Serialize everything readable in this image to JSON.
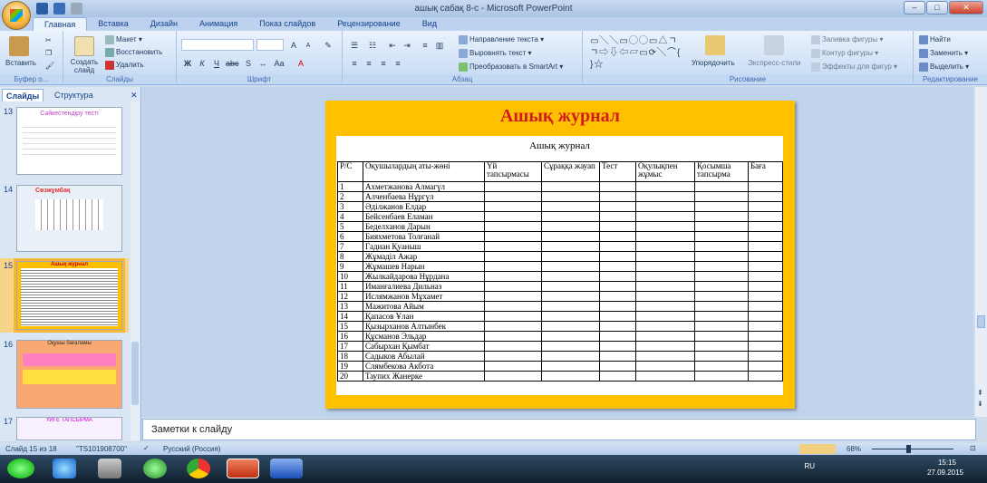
{
  "window": {
    "title": "ашық сабақ 8-с - Microsoft PowerPoint"
  },
  "ribbon_tabs": [
    "Главная",
    "Вставка",
    "Дизайн",
    "Анимация",
    "Показ слайдов",
    "Рецензирование",
    "Вид"
  ],
  "ribbon": {
    "clipboard": {
      "paste": "Вставить",
      "label": "Буфер о..."
    },
    "slides": {
      "new_slide": "Создать слайд",
      "layout": "Макет",
      "reset": "Восстановить",
      "delete": "Удалить",
      "label": "Слайды"
    },
    "font": {
      "label": "Шрифт"
    },
    "paragraph": {
      "text_direction": "Направление текста",
      "align_text": "Выровнять текст",
      "smartart": "Преобразовать в SmartArt",
      "label": "Абзац"
    },
    "drawing": {
      "arrange": "Упорядочить",
      "quick_styles": "Экспресс-стили",
      "shape_fill": "Заливка фигуры",
      "shape_outline": "Контур фигуры",
      "shape_effects": "Эффекты для фигур",
      "label": "Рисование"
    },
    "editing": {
      "find": "Найти",
      "replace": "Заменить",
      "select": "Выделить",
      "label": "Редактирование"
    }
  },
  "panel": {
    "tab_slides": "Слайды",
    "tab_outline": "Структура",
    "slides": [
      {
        "num": "13",
        "title": "Сәйкестендіру тесті"
      },
      {
        "num": "14",
        "title": "Сөзжұмбақ"
      },
      {
        "num": "15",
        "title": "Ашық журнал"
      },
      {
        "num": "16",
        "title": "Оқушы бағаламы"
      },
      {
        "num": "17",
        "title": "ҮЙГЕ ТАПСЫРМА"
      }
    ]
  },
  "slide": {
    "title": "Ашық журнал",
    "table_title": "Ашық журнал",
    "headers": [
      "Р/С",
      "Оқушылардың аты-жөні",
      "Үй тапсырмасы",
      "Сұраққа жауап",
      "Тест",
      "Оқулықпен жұмыс",
      "Қосымша тапсырма",
      "Баға"
    ],
    "students": [
      "Ахметжанова Алмагүл",
      "Алченбаева Нұргүл",
      "Әділжанов Елдар",
      "Бейсенбаев Еламан",
      "Беделханов Дарын",
      "Бияхметова Толғанай",
      "Гадиан Қуаныш",
      "Жұмаділ Ажар",
      "Жұмашев Нарын",
      "Жылкайдарова Нұрдана",
      "Иманғалиева Дильназ",
      "Ислямжанов Мұхамет",
      "Мажитова Айым",
      "Қапасов Ұлан",
      "Қызырханов Алтынбек",
      "Құсманов Эльдар",
      "Сабырхан Қымбат",
      "Садыков Абылай",
      "Слямбекова Акбота",
      "Таупих Жанерке"
    ]
  },
  "notes_placeholder": "Заметки к слайду",
  "status": {
    "slide": "Слайд 15 из 18",
    "theme": "\"TS101908700\"",
    "language": "Русский (Россия)",
    "zoom": "68%"
  },
  "taskbar": {
    "lang": "RU",
    "time": "15:15",
    "date": "27.09.2015"
  }
}
